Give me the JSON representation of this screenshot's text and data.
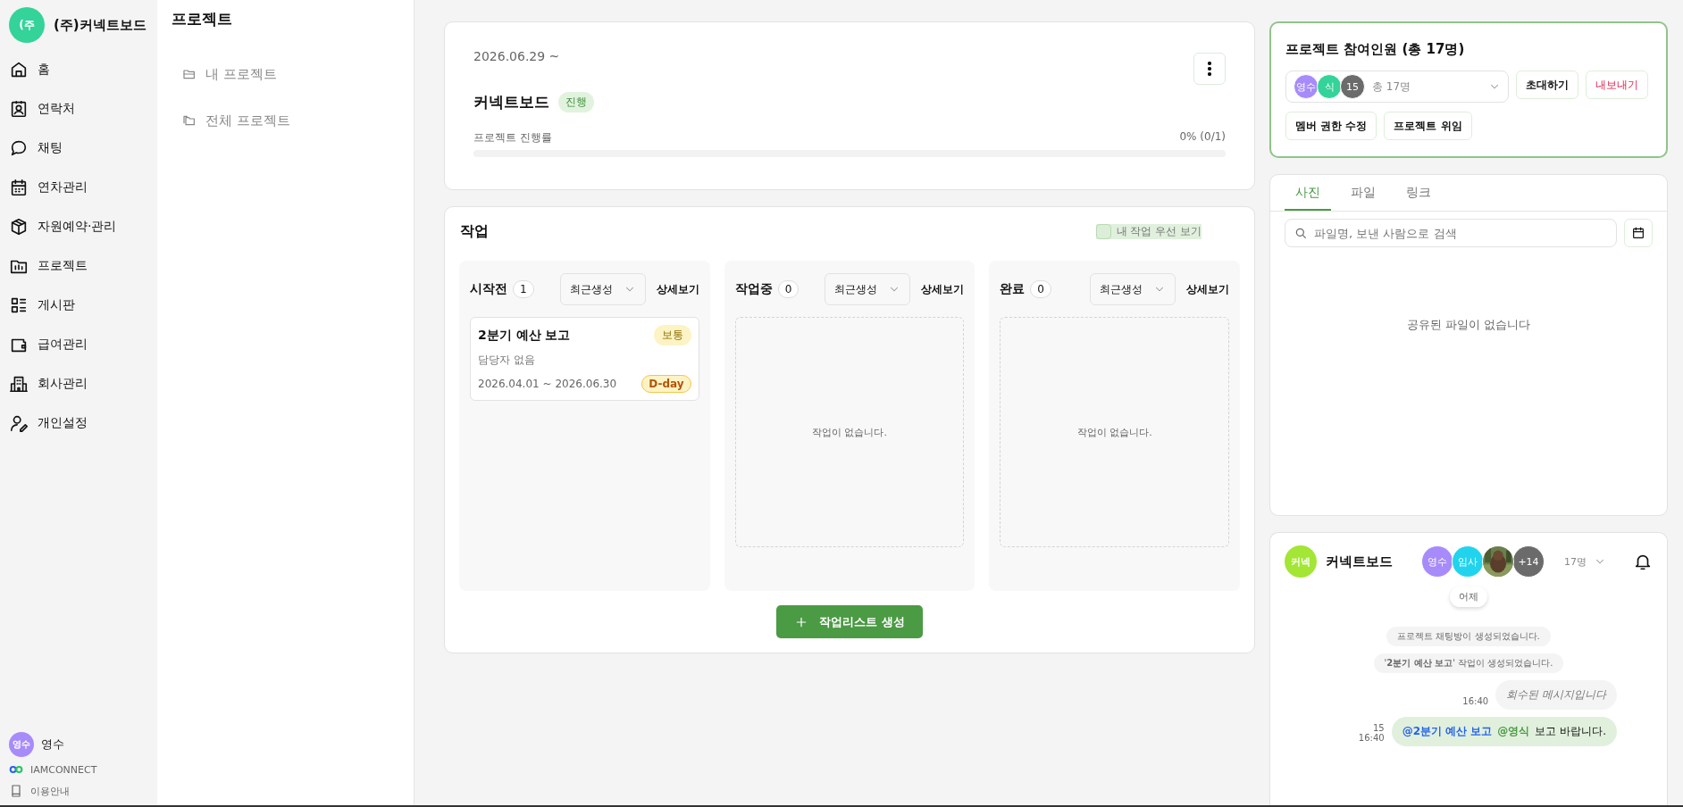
{
  "sidebar": {
    "company": {
      "avatar": "(주",
      "name": "(주)커넥트보드"
    },
    "items": [
      {
        "label": "홈"
      },
      {
        "label": "연락처"
      },
      {
        "label": "채팅"
      },
      {
        "label": "연차관리"
      },
      {
        "label": "자원예약·관리"
      },
      {
        "label": "프로젝트"
      },
      {
        "label": "게시판"
      },
      {
        "label": "급여관리"
      },
      {
        "label": "회사관리"
      },
      {
        "label": "개인설정"
      }
    ],
    "user": {
      "avatar": "영수",
      "name": "영수"
    },
    "links": [
      {
        "label": "IAMCONNECT"
      },
      {
        "label": "이용안내"
      }
    ]
  },
  "subnav": {
    "title": "프로젝트",
    "items": [
      {
        "label": "내 프로젝트"
      },
      {
        "label": "전체 프로젝트"
      }
    ]
  },
  "project": {
    "date": "2026.06.29 ~",
    "name": "커넥트보드",
    "status": "진행",
    "progress_label": "프로젝트 진행률",
    "progress_text": "0% (0/1)",
    "level": 0
  },
  "tasks": {
    "title": "작업",
    "my_first": {
      "label": "내 작업 우선 보기",
      "checked": false
    },
    "columns": [
      {
        "title": "시작전",
        "count": "1",
        "sort": "최근생성",
        "detail": "상세보기",
        "cards": [
          {
            "title": "2분기 예산 보고",
            "priority": "보통",
            "assignee": "담당자 없음",
            "dates": "2026.04.01 ~ 2026.06.30",
            "due": "D-day"
          }
        ]
      },
      {
        "title": "작업중",
        "count": "0",
        "sort": "최근생성",
        "detail": "상세보기",
        "empty": "작업이 없습니다."
      },
      {
        "title": "완료",
        "count": "0",
        "sort": "최근생성",
        "detail": "상세보기",
        "empty": "작업이 없습니다."
      }
    ],
    "create_button": "작업리스트 생성"
  },
  "members": {
    "title": "프로젝트 참여인원 (총 17명)",
    "avatars": [
      {
        "text": "영수",
        "color": "#a78bfa"
      },
      {
        "text": "식",
        "color": "#34d399"
      },
      {
        "text": "15",
        "color": "#6b6b6b"
      }
    ],
    "summary": "총 17명",
    "buttons": [
      {
        "label": "초대하기",
        "kind": "normal"
      },
      {
        "label": "내보내기",
        "kind": "danger"
      },
      {
        "label": "멤버 권한 수정",
        "kind": "normal"
      },
      {
        "label": "프로젝트 위임",
        "kind": "normal"
      }
    ]
  },
  "files": {
    "tabs": [
      {
        "label": "사진",
        "selected": true
      },
      {
        "label": "파일",
        "selected": false
      },
      {
        "label": "링크",
        "selected": false
      }
    ],
    "search_placeholder": "파일명, 보낸 사람으로 검색",
    "empty": "공유된 파일이 없습니다"
  },
  "chat": {
    "avatar": "커넥",
    "title": "커넥트보드",
    "members": [
      {
        "kind": "text",
        "text": "영수",
        "color": "#a78bfa"
      },
      {
        "kind": "text",
        "text": "임사",
        "color": "#22d3ee"
      },
      {
        "kind": "picture"
      },
      {
        "kind": "text",
        "text": "+14",
        "color": "#6b6b6b"
      }
    ],
    "count": "17명",
    "date": "어제",
    "messages": [
      {
        "kind": "system",
        "text": "프로젝트 채팅방이 생성되었습니다."
      },
      {
        "kind": "system",
        "text": "'**2분기 예산 보고**' 작업이 생성되었습니다."
      },
      {
        "kind": "retracted",
        "text": "회수된 메시지입니다",
        "time": "16:40"
      },
      {
        "kind": "mine",
        "unread": "15",
        "time": "16:40",
        "parts": [
          {
            "kind": "task",
            "text": "@2분기 예산 보고"
          },
          {
            "kind": "user",
            "text": "@영식"
          },
          {
            "kind": "text",
            "text": "보고 바랍니다."
          }
        ]
      }
    ]
  }
}
